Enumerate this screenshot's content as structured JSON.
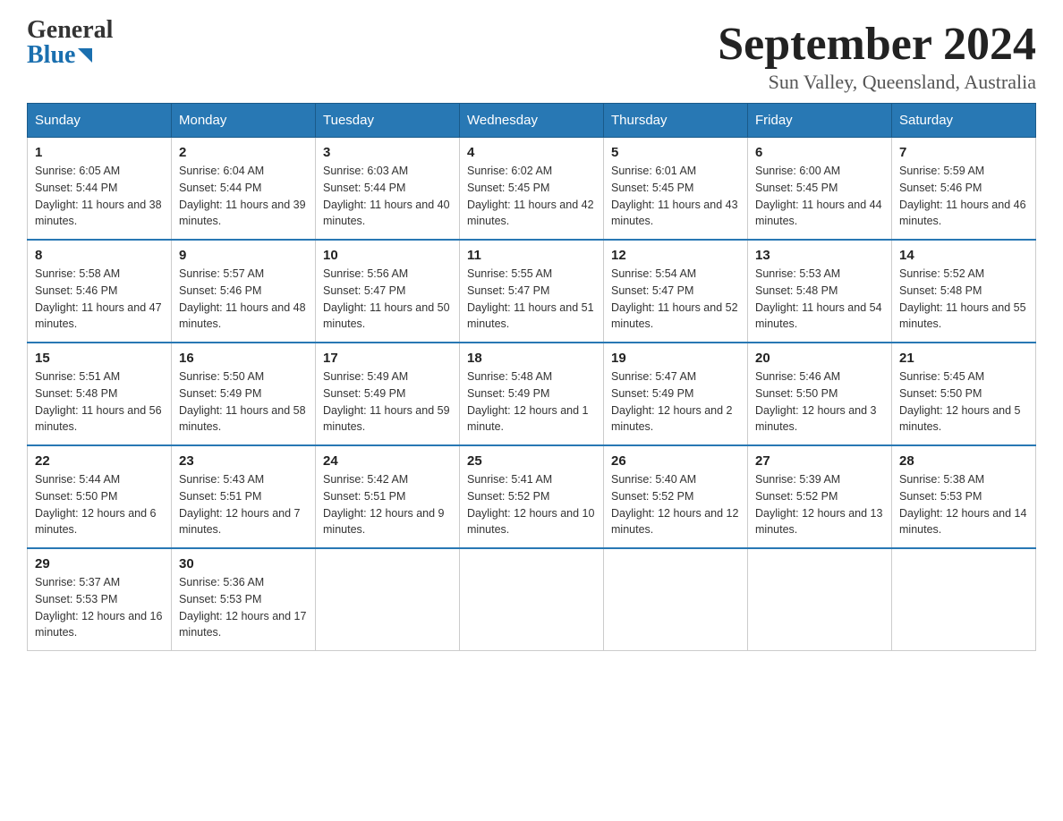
{
  "header": {
    "logo_general": "General",
    "logo_blue": "Blue",
    "month_title": "September 2024",
    "location": "Sun Valley, Queensland, Australia"
  },
  "calendar": {
    "days_of_week": [
      "Sunday",
      "Monday",
      "Tuesday",
      "Wednesday",
      "Thursday",
      "Friday",
      "Saturday"
    ],
    "weeks": [
      [
        {
          "day": "1",
          "sunrise": "6:05 AM",
          "sunset": "5:44 PM",
          "daylight": "11 hours and 38 minutes."
        },
        {
          "day": "2",
          "sunrise": "6:04 AM",
          "sunset": "5:44 PM",
          "daylight": "11 hours and 39 minutes."
        },
        {
          "day": "3",
          "sunrise": "6:03 AM",
          "sunset": "5:44 PM",
          "daylight": "11 hours and 40 minutes."
        },
        {
          "day": "4",
          "sunrise": "6:02 AM",
          "sunset": "5:45 PM",
          "daylight": "11 hours and 42 minutes."
        },
        {
          "day": "5",
          "sunrise": "6:01 AM",
          "sunset": "5:45 PM",
          "daylight": "11 hours and 43 minutes."
        },
        {
          "day": "6",
          "sunrise": "6:00 AM",
          "sunset": "5:45 PM",
          "daylight": "11 hours and 44 minutes."
        },
        {
          "day": "7",
          "sunrise": "5:59 AM",
          "sunset": "5:46 PM",
          "daylight": "11 hours and 46 minutes."
        }
      ],
      [
        {
          "day": "8",
          "sunrise": "5:58 AM",
          "sunset": "5:46 PM",
          "daylight": "11 hours and 47 minutes."
        },
        {
          "day": "9",
          "sunrise": "5:57 AM",
          "sunset": "5:46 PM",
          "daylight": "11 hours and 48 minutes."
        },
        {
          "day": "10",
          "sunrise": "5:56 AM",
          "sunset": "5:47 PM",
          "daylight": "11 hours and 50 minutes."
        },
        {
          "day": "11",
          "sunrise": "5:55 AM",
          "sunset": "5:47 PM",
          "daylight": "11 hours and 51 minutes."
        },
        {
          "day": "12",
          "sunrise": "5:54 AM",
          "sunset": "5:47 PM",
          "daylight": "11 hours and 52 minutes."
        },
        {
          "day": "13",
          "sunrise": "5:53 AM",
          "sunset": "5:48 PM",
          "daylight": "11 hours and 54 minutes."
        },
        {
          "day": "14",
          "sunrise": "5:52 AM",
          "sunset": "5:48 PM",
          "daylight": "11 hours and 55 minutes."
        }
      ],
      [
        {
          "day": "15",
          "sunrise": "5:51 AM",
          "sunset": "5:48 PM",
          "daylight": "11 hours and 56 minutes."
        },
        {
          "day": "16",
          "sunrise": "5:50 AM",
          "sunset": "5:49 PM",
          "daylight": "11 hours and 58 minutes."
        },
        {
          "day": "17",
          "sunrise": "5:49 AM",
          "sunset": "5:49 PM",
          "daylight": "11 hours and 59 minutes."
        },
        {
          "day": "18",
          "sunrise": "5:48 AM",
          "sunset": "5:49 PM",
          "daylight": "12 hours and 1 minute."
        },
        {
          "day": "19",
          "sunrise": "5:47 AM",
          "sunset": "5:49 PM",
          "daylight": "12 hours and 2 minutes."
        },
        {
          "day": "20",
          "sunrise": "5:46 AM",
          "sunset": "5:50 PM",
          "daylight": "12 hours and 3 minutes."
        },
        {
          "day": "21",
          "sunrise": "5:45 AM",
          "sunset": "5:50 PM",
          "daylight": "12 hours and 5 minutes."
        }
      ],
      [
        {
          "day": "22",
          "sunrise": "5:44 AM",
          "sunset": "5:50 PM",
          "daylight": "12 hours and 6 minutes."
        },
        {
          "day": "23",
          "sunrise": "5:43 AM",
          "sunset": "5:51 PM",
          "daylight": "12 hours and 7 minutes."
        },
        {
          "day": "24",
          "sunrise": "5:42 AM",
          "sunset": "5:51 PM",
          "daylight": "12 hours and 9 minutes."
        },
        {
          "day": "25",
          "sunrise": "5:41 AM",
          "sunset": "5:52 PM",
          "daylight": "12 hours and 10 minutes."
        },
        {
          "day": "26",
          "sunrise": "5:40 AM",
          "sunset": "5:52 PM",
          "daylight": "12 hours and 12 minutes."
        },
        {
          "day": "27",
          "sunrise": "5:39 AM",
          "sunset": "5:52 PM",
          "daylight": "12 hours and 13 minutes."
        },
        {
          "day": "28",
          "sunrise": "5:38 AM",
          "sunset": "5:53 PM",
          "daylight": "12 hours and 14 minutes."
        }
      ],
      [
        {
          "day": "29",
          "sunrise": "5:37 AM",
          "sunset": "5:53 PM",
          "daylight": "12 hours and 16 minutes."
        },
        {
          "day": "30",
          "sunrise": "5:36 AM",
          "sunset": "5:53 PM",
          "daylight": "12 hours and 17 minutes."
        },
        null,
        null,
        null,
        null,
        null
      ]
    ]
  }
}
